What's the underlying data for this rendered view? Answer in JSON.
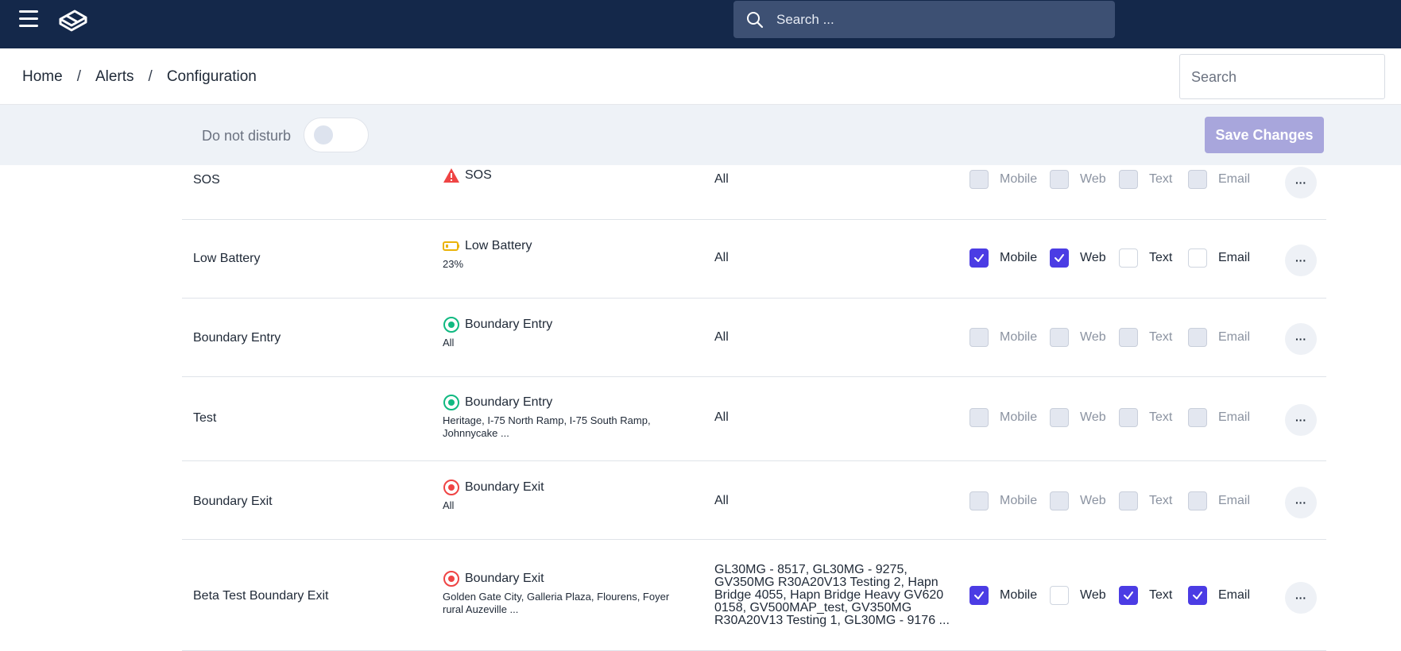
{
  "topbar": {
    "search_placeholder": "Search ..."
  },
  "breadcrumb": {
    "items": [
      "Home",
      "Alerts",
      "Configuration"
    ],
    "separator": "/"
  },
  "header": {
    "search_placeholder": "Search"
  },
  "toolbar": {
    "dnd_label": "Do not disturb",
    "dnd_on": false,
    "save_label": "Save Changes"
  },
  "colors": {
    "navbar": "#14284a",
    "accent": "#4b3ce4",
    "save_disabled": "#a8a6dc",
    "sos_red": "#ef4444",
    "battery_yellow": "#eab308",
    "entry_green": "#10b981",
    "exit_red": "#ef4444"
  },
  "channel_labels": {
    "mobile": "Mobile",
    "web": "Web",
    "text": "Text",
    "email": "Email"
  },
  "more_label": "···",
  "rows": [
    {
      "name": "SOS",
      "type_icon": "warning-icon",
      "type": "SOS",
      "sub": "",
      "scope": "All",
      "channels": {
        "mobile": "disabled",
        "web": "disabled",
        "text": "disabled",
        "email": "disabled"
      }
    },
    {
      "name": "Low Battery",
      "type_icon": "battery-icon",
      "type": "Low Battery",
      "sub": "23%",
      "scope": "All",
      "channels": {
        "mobile": "on",
        "web": "on",
        "text": "off",
        "email": "off"
      }
    },
    {
      "name": "Boundary Entry",
      "type_icon": "boundary-entry-icon",
      "type": "Boundary Entry",
      "sub": "All",
      "scope": "All",
      "channels": {
        "mobile": "disabled",
        "web": "disabled",
        "text": "disabled",
        "email": "disabled"
      }
    },
    {
      "name": "Test",
      "type_icon": "boundary-entry-icon",
      "type": "Boundary Entry",
      "sub": "Heritage, I-75 North Ramp, I-75 South Ramp, Johnnycake ...",
      "scope": "All",
      "channels": {
        "mobile": "disabled",
        "web": "disabled",
        "text": "disabled",
        "email": "disabled"
      }
    },
    {
      "name": "Boundary Exit",
      "type_icon": "boundary-exit-icon",
      "type": "Boundary Exit",
      "sub": "All",
      "scope": "All",
      "channels": {
        "mobile": "disabled",
        "web": "disabled",
        "text": "disabled",
        "email": "disabled"
      }
    },
    {
      "name": "Beta Test Boundary Exit",
      "type_icon": "boundary-exit-icon",
      "type": "Boundary Exit",
      "sub": "Golden Gate City, Galleria Plaza, Flourens, Foyer rural Auzeville ...",
      "scope": "GL30MG - 8517, GL30MG - 9275, GV350MG R30A20V13 Testing 2, Hapn Bridge 4055, Hapn Bridge Heavy GV620 0158, GV500MAP_test, GV350MG R30A20V13 Testing 1, GL30MG - 9176 ...",
      "channels": {
        "mobile": "on",
        "web": "off",
        "text": "on",
        "email": "on"
      }
    }
  ]
}
